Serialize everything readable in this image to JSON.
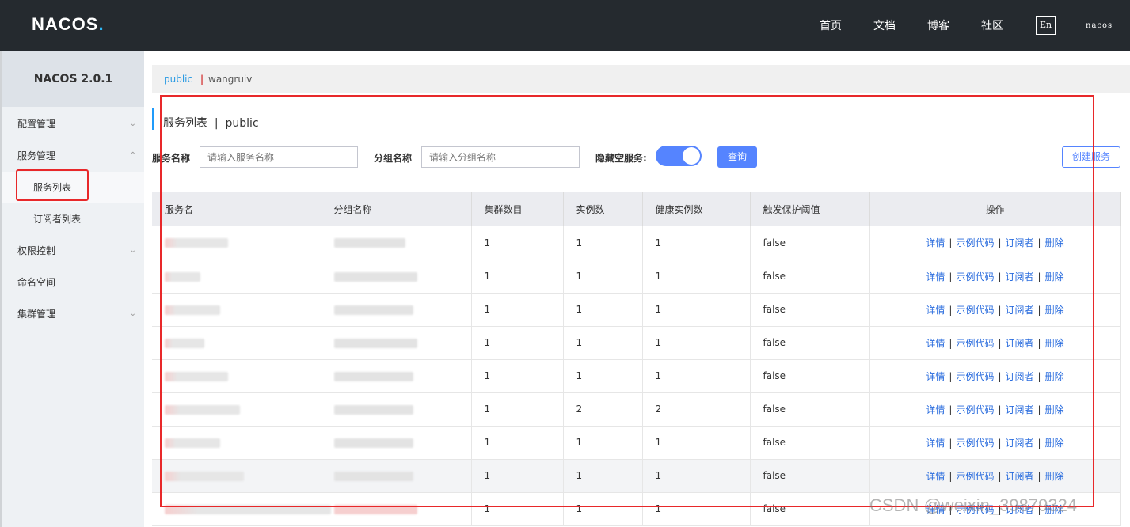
{
  "header": {
    "logo": "NACOS.",
    "nav": [
      "首页",
      "文档",
      "博客",
      "社区"
    ],
    "lang": "En",
    "user": "nacos"
  },
  "sidebar": {
    "title": "NACOS 2.0.1",
    "items": [
      {
        "label": "配置管理",
        "type": "group",
        "expanded": false
      },
      {
        "label": "服务管理",
        "type": "group",
        "expanded": true
      },
      {
        "label": "服务列表",
        "type": "sub",
        "active": true
      },
      {
        "label": "订阅者列表",
        "type": "sub"
      },
      {
        "label": "权限控制",
        "type": "group",
        "expanded": false
      },
      {
        "label": "命名空间",
        "type": "item"
      },
      {
        "label": "集群管理",
        "type": "group",
        "expanded": false
      }
    ]
  },
  "namespaces": {
    "current": "public",
    "separator": "|",
    "other": "wangruiv"
  },
  "page": {
    "title": "服务列表  |  public"
  },
  "search": {
    "service_label": "服务名称",
    "service_placeholder": "请输入服务名称",
    "group_label": "分组名称",
    "group_placeholder": "请输入分组名称",
    "hide_empty_label": "隐藏空服务:",
    "hide_empty_on": true,
    "query_button": "查询",
    "create_button": "创建服务"
  },
  "table": {
    "columns": [
      "服务名",
      "分组名称",
      "集群数目",
      "实例数",
      "健康实例数",
      "触发保护阈值",
      "操作"
    ],
    "actions": [
      "详情",
      "示例代码",
      "订阅者",
      "删除"
    ],
    "rows": [
      {
        "clusters": "1",
        "instances": "1",
        "healthy": "1",
        "threshold": "false"
      },
      {
        "clusters": "1",
        "instances": "1",
        "healthy": "1",
        "threshold": "false"
      },
      {
        "clusters": "1",
        "instances": "1",
        "healthy": "1",
        "threshold": "false"
      },
      {
        "clusters": "1",
        "instances": "1",
        "healthy": "1",
        "threshold": "false"
      },
      {
        "clusters": "1",
        "instances": "1",
        "healthy": "1",
        "threshold": "false"
      },
      {
        "clusters": "1",
        "instances": "2",
        "healthy": "2",
        "threshold": "false"
      },
      {
        "clusters": "1",
        "instances": "1",
        "healthy": "1",
        "threshold": "false"
      },
      {
        "clusters": "1",
        "instances": "1",
        "healthy": "1",
        "threshold": "false"
      },
      {
        "clusters": "1",
        "instances": "1",
        "healthy": "1",
        "threshold": "false"
      }
    ]
  },
  "watermark": "CSDN @weixin_39879324"
}
